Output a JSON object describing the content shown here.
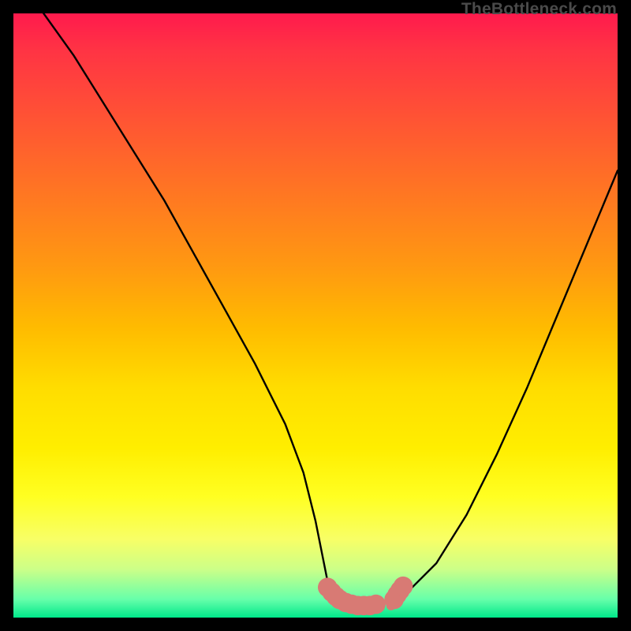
{
  "watermark": "TheBottleneck.com",
  "chart_data": {
    "type": "line",
    "title": "",
    "xlabel": "",
    "ylabel": "",
    "xlim": [
      0,
      100
    ],
    "ylim": [
      0,
      100
    ],
    "series": [
      {
        "name": "bottleneck-curve",
        "x": [
          0,
          5,
          10,
          15,
          20,
          25,
          30,
          35,
          40,
          45,
          48,
          50,
          52,
          54,
          56,
          58,
          60,
          63,
          66,
          70,
          75,
          80,
          85,
          90,
          95,
          100
        ],
        "y": [
          106,
          100,
          93,
          85,
          77,
          69,
          60,
          51,
          42,
          32,
          24,
          16,
          6,
          3,
          2,
          2,
          2,
          3,
          5,
          9,
          17,
          27,
          38,
          50,
          62,
          74
        ]
      }
    ],
    "markers": [
      {
        "x": 52.0,
        "y": 5.0,
        "r": 1.6
      },
      {
        "x": 52.7,
        "y": 4.2,
        "r": 1.6
      },
      {
        "x": 53.4,
        "y": 3.5,
        "r": 1.6
      },
      {
        "x": 54.0,
        "y": 3.0,
        "r": 1.6
      },
      {
        "x": 55.0,
        "y": 2.5,
        "r": 1.6
      },
      {
        "x": 56.0,
        "y": 2.2,
        "r": 1.6
      },
      {
        "x": 57.0,
        "y": 2.0,
        "r": 1.6
      },
      {
        "x": 58.0,
        "y": 2.0,
        "r": 1.6
      },
      {
        "x": 59.0,
        "y": 2.0,
        "r": 1.6
      },
      {
        "x": 60.0,
        "y": 2.2,
        "r": 1.6
      },
      {
        "x": 62.5,
        "y": 2.0,
        "r": 0.8
      },
      {
        "x": 63.0,
        "y": 3.0,
        "r": 1.6
      },
      {
        "x": 63.5,
        "y": 3.8,
        "r": 1.6
      },
      {
        "x": 64.0,
        "y": 4.5,
        "r": 1.6
      },
      {
        "x": 64.5,
        "y": 5.2,
        "r": 1.6
      }
    ],
    "colors": {
      "curve": "#000000",
      "marker": "#d87a74"
    }
  }
}
